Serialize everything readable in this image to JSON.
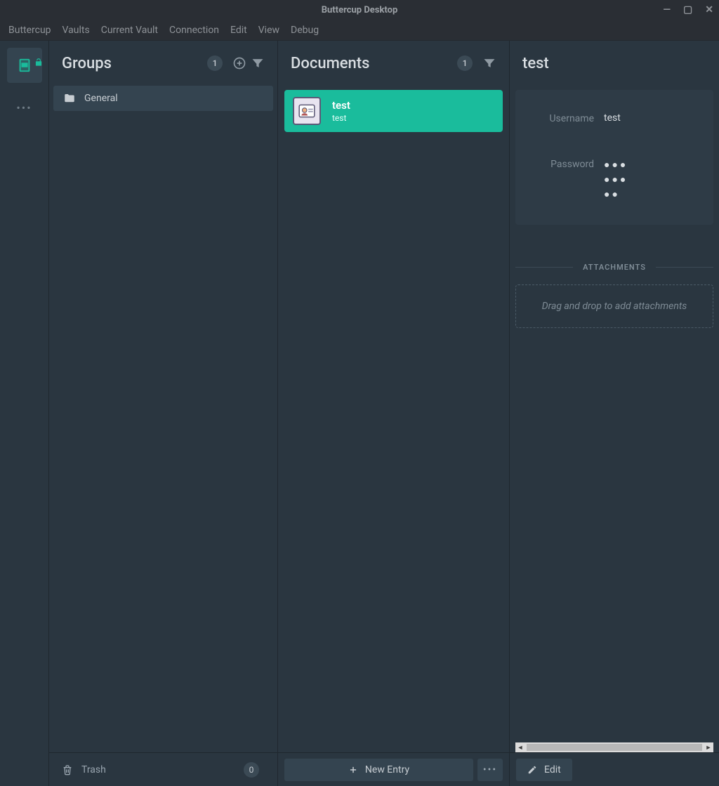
{
  "window": {
    "title": "Buttercup Desktop"
  },
  "menubar": [
    "Buttercup",
    "Vaults",
    "Current Vault",
    "Connection",
    "Edit",
    "View",
    "Debug"
  ],
  "groups": {
    "heading": "Groups",
    "count": "1",
    "items": [
      {
        "label": "General"
      }
    ],
    "trash": {
      "label": "Trash",
      "count": "0"
    }
  },
  "documents": {
    "heading": "Documents",
    "count": "1",
    "items": [
      {
        "title": "test",
        "subtitle": "test"
      }
    ],
    "new_entry_label": "New Entry"
  },
  "details": {
    "heading": "test",
    "fields": {
      "username_label": "Username",
      "username_value": "test",
      "password_label": "Password",
      "password_value": "●●●\n●●●\n●●"
    },
    "attachments_heading": "ATTACHMENTS",
    "dropzone_text": "Drag and drop to add attachments",
    "edit_label": "Edit"
  }
}
